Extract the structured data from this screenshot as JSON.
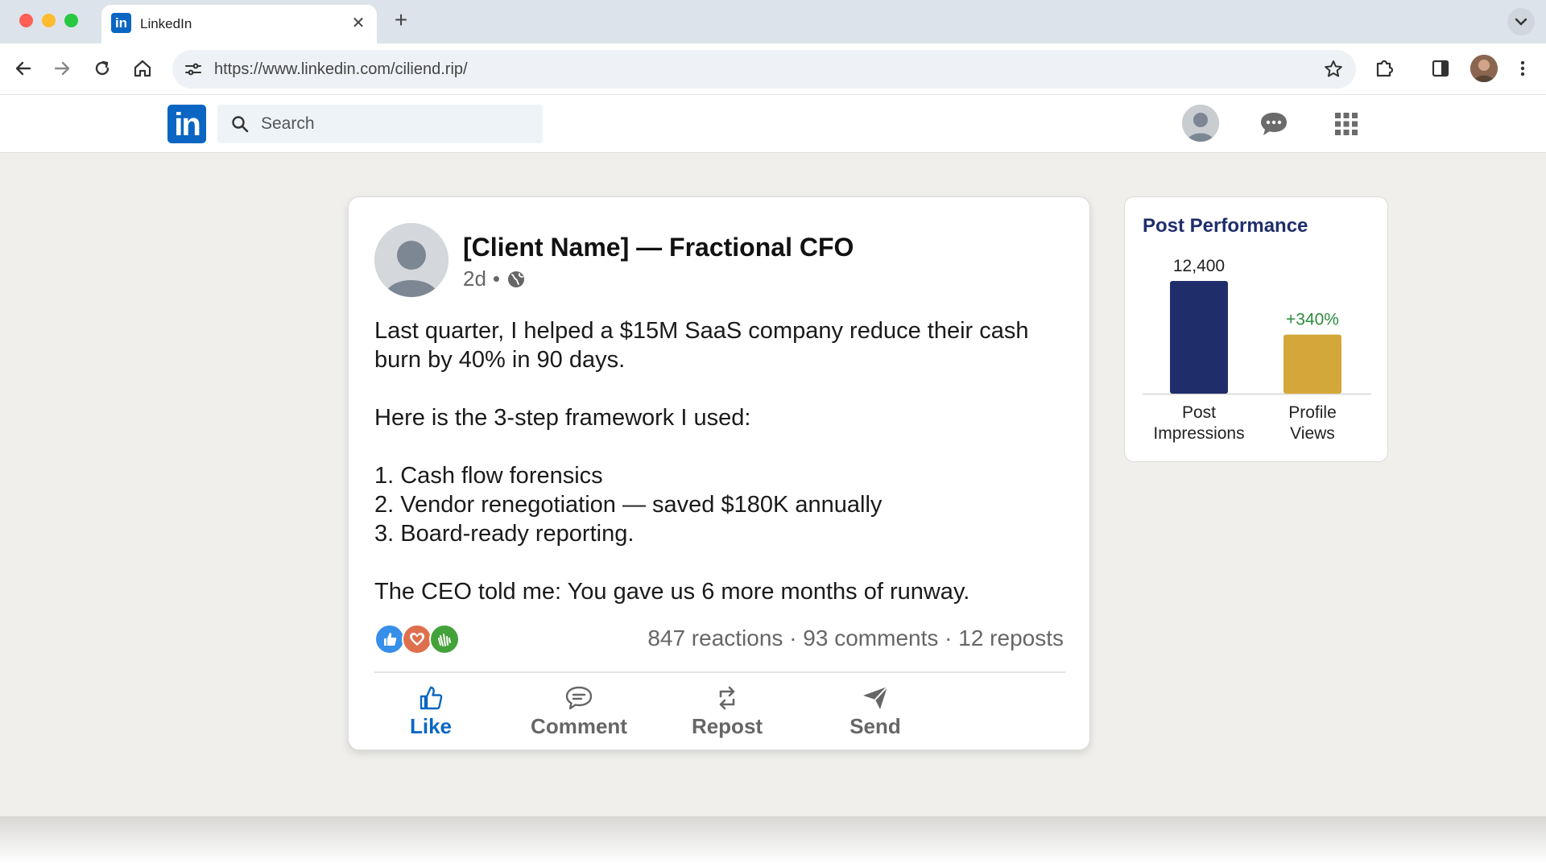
{
  "browser": {
    "tab_title": "LinkedIn",
    "tab_favicon": "in",
    "url": "https://www.linkedin.com/ciliend.rip/"
  },
  "nav": {
    "logo": "in",
    "search_placeholder": "Search"
  },
  "post": {
    "author": "[Client Name] — Fractional CFO",
    "time": "2d",
    "separator": "•",
    "body": [
      "Last quarter, I helped a $15M SaaS company reduce their cash burn by 40% in 90 days.",
      "",
      "Here is the 3-step framework I used:",
      "",
      "1. Cash flow forensics",
      "2. Vendor renegotiation — saved $180K annually",
      "3. Board-ready reporting.",
      "",
      "The CEO told me: You gave us 6 more months of runway."
    ],
    "counts": "847 reactions · 93 comments · 12 reposts",
    "actions": {
      "like": "Like",
      "comment": "Comment",
      "repost": "Repost",
      "send": "Send"
    },
    "colors": {
      "accent": "#0a66c2"
    }
  },
  "performance": {
    "title": "Post Performance",
    "chart_data": {
      "type": "bar",
      "categories": [
        "Post Impressions",
        "Profile Views"
      ],
      "data_labels": [
        "12,400",
        "+340%"
      ],
      "label_colors": [
        "#222222",
        "#2e8b3e"
      ],
      "bar_colors": [
        "#1f2e6b",
        "#d4a73a"
      ],
      "values": [
        12400,
        6500
      ],
      "ylim": [
        0,
        12400
      ]
    }
  }
}
